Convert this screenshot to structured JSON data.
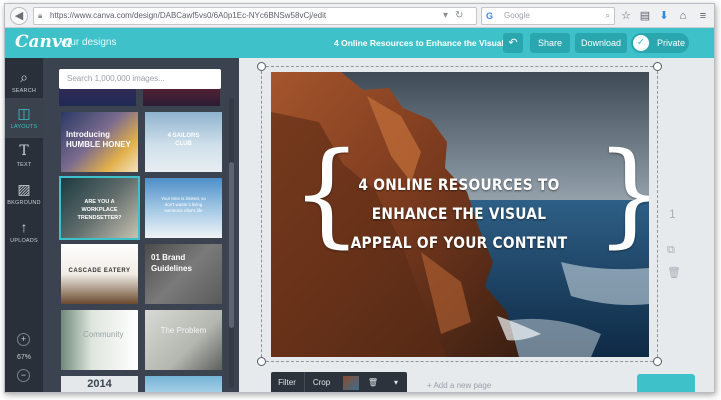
{
  "browser": {
    "url": "https://www.canva.com/design/DABCawf5vs0/6A0p1Ec-NYc6BNSw58vCj/edit",
    "search_placeholder": "Google"
  },
  "header": {
    "logo": "Canva",
    "your_designs": "Your designs",
    "doc_title": "4 Online Resources to Enhance the Visual",
    "share_label": "Share",
    "download_label": "Download",
    "private_label": "Private",
    "accent_color": "#3fc1c9"
  },
  "sidebar": {
    "items": [
      {
        "label": "SEARCH",
        "icon": "search-icon"
      },
      {
        "label": "LAYOUTS",
        "icon": "layouts-icon"
      },
      {
        "label": "TEXT",
        "icon": "text-icon"
      },
      {
        "label": "BKGROUND",
        "icon": "background-icon"
      },
      {
        "label": "UPLOADS",
        "icon": "upload-icon"
      }
    ],
    "zoom_in": "+",
    "zoom_level": "67%",
    "zoom_out": "−"
  },
  "library": {
    "search_placeholder": "Search 1,000,000 images...",
    "thumbnails": [
      {
        "text": "Introducing HUMBLE HONEY"
      },
      {
        "text": "4 SAILORS CLUB"
      },
      {
        "text": "ARE YOU A WORKPLACE TRENDSETTER?"
      },
      {
        "text": "Your time is limited, so don't waste it living someone else's life"
      },
      {
        "text": "CASCADE EATERY"
      },
      {
        "text": "01 Brand Guidelines"
      },
      {
        "text": "Community"
      },
      {
        "text": "The Problem"
      },
      {
        "text": "2014"
      },
      {
        "text": ""
      }
    ]
  },
  "canvas": {
    "headline": "4 ONLINE RESOURCES TO ENHANCE THE VISUAL APPEAL OF YOUR CONTENT",
    "page_number": "1",
    "toolbar": {
      "filter_label": "Filter",
      "crop_label": "Crop"
    },
    "add_page_label": "+ Add a new page"
  }
}
